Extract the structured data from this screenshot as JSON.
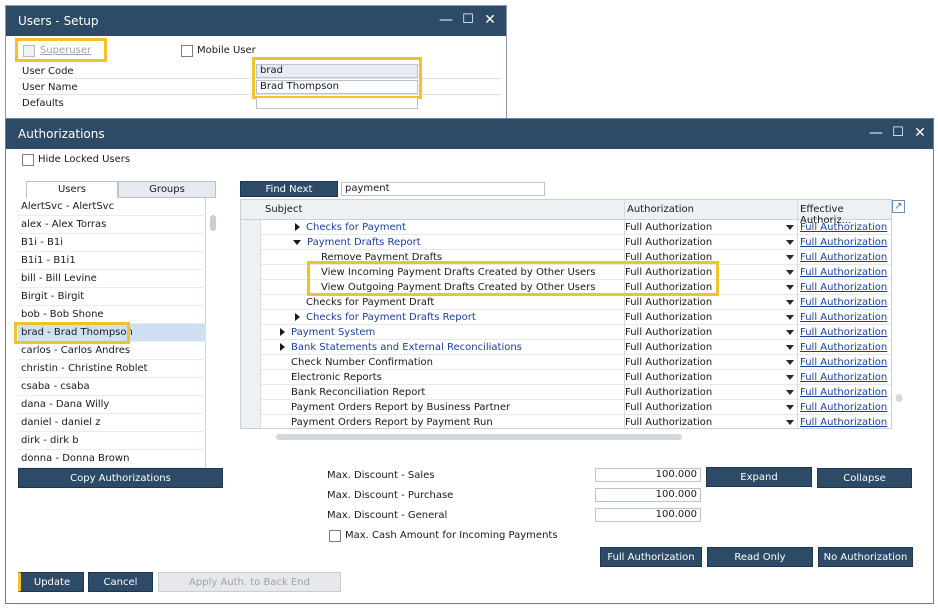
{
  "users_setup": {
    "title": "Users - Setup",
    "superuser_label": "Superuser",
    "mobile_user_label": "Mobile User",
    "user_code_label": "User Code",
    "user_code_value": "brad",
    "user_name_label": "User Name",
    "user_name_value": "Brad Thompson",
    "defaults_label": "Defaults"
  },
  "authorizations": {
    "title": "Authorizations",
    "hide_locked_label": "Hide Locked Users",
    "tabs": {
      "users": "Users",
      "groups": "Groups"
    },
    "users": [
      "AlertSvc - AlertSvc",
      "alex - Alex Torras",
      "B1i - B1i",
      "B1i1 - B1i1",
      "bill - Bill Levine",
      "Birgit - Birgit",
      "bob - Bob Shone",
      "brad - Brad Thompson",
      "carlos - Carlos Andres",
      "christin - Christine Roblet",
      "csaba - csaba",
      "dana - Dana Willy",
      "daniel - daniel z",
      "dirk - dirk b",
      "donna - Donna Brown"
    ],
    "selected_user": "brad - Brad Thompson",
    "copy_auth_label": "Copy Authorizations",
    "find_next_label": "Find Next",
    "search_value": "payment",
    "columns": {
      "subject": "Subject",
      "authorization": "Authorization",
      "effective": "Effective Authoriz..."
    },
    "rows": [
      {
        "subject": "Checks for Payment",
        "auth": "Full Authorization",
        "eff": "Full Authorization"
      },
      {
        "subject": "Payment Drafts Report",
        "auth": "Full Authorization",
        "eff": "Full Authorization"
      },
      {
        "subject": "Remove Payment Drafts",
        "auth": "Full Authorization",
        "eff": "Full Authorization"
      },
      {
        "subject": "View Incoming Payment Drafts Created by Other Users",
        "auth": "Full Authorization",
        "eff": "Full Authorization"
      },
      {
        "subject": "View Outgoing Payment Drafts Created by Other Users",
        "auth": "Full Authorization",
        "eff": "Full Authorization"
      },
      {
        "subject": "Checks for Payment Draft",
        "auth": "Full Authorization",
        "eff": "Full Authorization"
      },
      {
        "subject": "Checks for Payment Drafts Report",
        "auth": "Full Authorization",
        "eff": "Full Authorization"
      },
      {
        "subject": "Payment System",
        "auth": "Full Authorization",
        "eff": "Full Authorization"
      },
      {
        "subject": "Bank Statements and External Reconciliations",
        "auth": "Full Authorization",
        "eff": "Full Authorization"
      },
      {
        "subject": "Check Number Confirmation",
        "auth": "Full Authorization",
        "eff": "Full Authorization"
      },
      {
        "subject": "Electronic Reports",
        "auth": "Full Authorization",
        "eff": "Full Authorization"
      },
      {
        "subject": "Bank Reconciliation Report",
        "auth": "Full Authorization",
        "eff": "Full Authorization"
      },
      {
        "subject": "Payment Orders Report by Business Partner",
        "auth": "Full Authorization",
        "eff": "Full Authorization"
      },
      {
        "subject": "Payment Orders Report by Payment Run",
        "auth": "Full Authorization",
        "eff": "Full Authorization"
      }
    ],
    "max_discount_sales_label": "Max. Discount - Sales",
    "max_discount_sales_value": "100.000",
    "max_discount_purchase_label": "Max. Discount - Purchase",
    "max_discount_purchase_value": "100.000",
    "max_discount_general_label": "Max. Discount - General",
    "max_discount_general_value": "100.000",
    "max_cash_label": "Max. Cash Amount for Incoming Payments",
    "expand_label": "Expand",
    "collapse_label": "Collapse",
    "full_auth_label": "Full Authorization",
    "read_only_label": "Read Only",
    "no_auth_label": "No Authorization",
    "update_label": "Update",
    "cancel_label": "Cancel",
    "apply_label": "Apply Auth. to Back End"
  },
  "colors": {
    "title_bar": "#2d4a66",
    "highlight": "#f2c22e",
    "link": "#1b3f9c",
    "selected_row": "#cfe0f3"
  }
}
